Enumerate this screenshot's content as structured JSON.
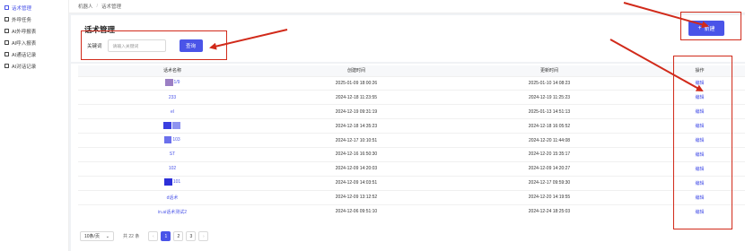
{
  "sidebar": {
    "items": [
      {
        "label": "话术管理",
        "active": true
      },
      {
        "label": "外呼任务",
        "active": false
      },
      {
        "label": "AI外呼报表",
        "active": false
      },
      {
        "label": "AI呼入报表",
        "active": false
      },
      {
        "label": "AI通话记录",
        "active": false
      },
      {
        "label": "AI对话记录",
        "active": false
      }
    ]
  },
  "breadcrumb": [
    "机器人",
    "话术管理"
  ],
  "page": {
    "title": "话术管理",
    "keyword_label": "关键词",
    "keyword_placeholder": "请输入关键词",
    "query_button": "查询",
    "new_button": "新建"
  },
  "table": {
    "headers": [
      "话术名称",
      "创建时间",
      "更新时间",
      "操作"
    ],
    "rows": [
      {
        "name": "1/9",
        "created": "2025-01-09 18:00:26",
        "updated": "2025-01-10 14:08:23",
        "op": "编辑"
      },
      {
        "name": "233",
        "created": "2024-12-18 11:23:55",
        "updated": "2024-12-19 11:25:23",
        "op": "编辑"
      },
      {
        "name": "el",
        "created": "2024-12-19 09:31:19",
        "updated": "2025-01-13 14:51:13",
        "op": "编辑"
      },
      {
        "name": "",
        "created": "2024-12-18 14:35:23",
        "updated": "2024-12-18 16:05:52",
        "op": "编辑"
      },
      {
        "name": "103",
        "created": "2024-12-17 10:10:51",
        "updated": "2024-12-20 11:44:08",
        "op": "编辑"
      },
      {
        "name": "ST",
        "created": "2024-12-16 16:50:30",
        "updated": "2024-12-20 15:35:17",
        "op": "编辑"
      },
      {
        "name": "102",
        "created": "2024-12-09 14:20:03",
        "updated": "2024-12-09 14:20:27",
        "op": "编辑"
      },
      {
        "name": "101",
        "created": "2024-12-09 14:03:51",
        "updated": "2024-12-17 09:59:30",
        "op": "编辑"
      },
      {
        "name": "d话术",
        "created": "2024-12-09 13:12:52",
        "updated": "2024-12-20 14:19:55",
        "op": "编辑"
      },
      {
        "name": "in.ai话术测试2",
        "created": "2024-12-06 09:51:10",
        "updated": "2024-12-24 18:25:03",
        "op": "编辑"
      }
    ]
  },
  "pagination": {
    "page_size": "10条/页",
    "total": "共 22 条",
    "pages": [
      "1",
      "2",
      "3"
    ],
    "current": "1"
  },
  "colors": {
    "accent": "#4a54e8",
    "annotation": "#d12a1a"
  }
}
